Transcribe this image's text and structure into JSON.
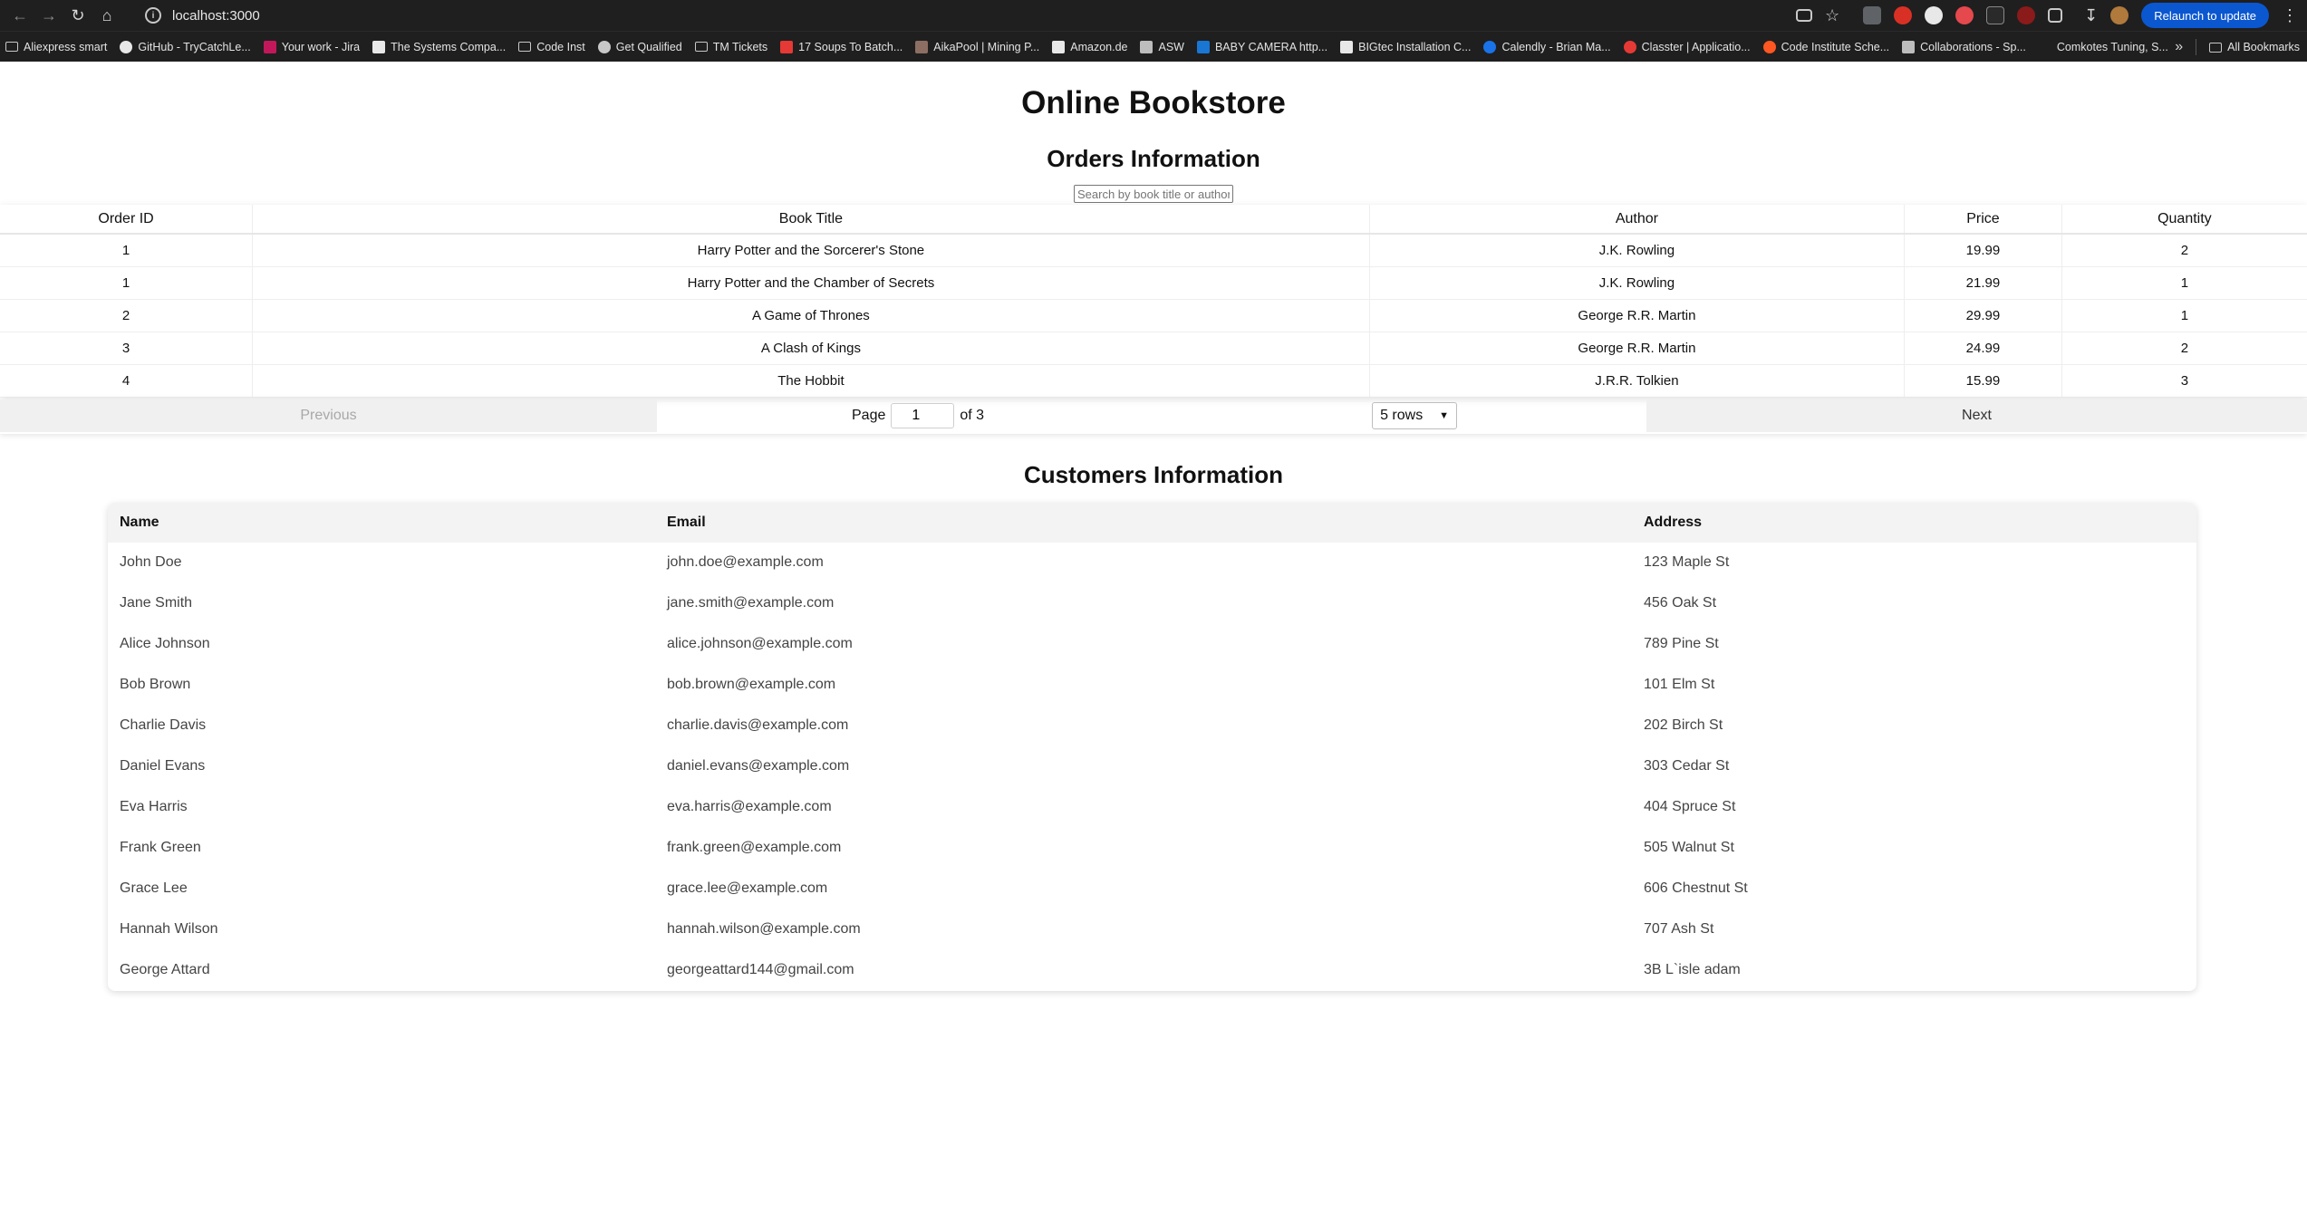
{
  "browser": {
    "url": "localhost:3000",
    "relaunch_label": "Relaunch to update",
    "bookmarks": [
      {
        "label": "Aliexpress smart",
        "icon": "folder-icon"
      },
      {
        "label": "GitHub - TryCatchLe...",
        "icon": "github-icon"
      },
      {
        "label": "Your work - Jira",
        "icon": "jira-icon"
      },
      {
        "label": "The Systems Compa...",
        "icon": "systems-icon"
      },
      {
        "label": "Code Inst",
        "icon": "folder-icon"
      },
      {
        "label": "Get Qualified",
        "icon": "globe-icon"
      },
      {
        "label": "TM Tickets",
        "icon": "folder-icon"
      },
      {
        "label": "17 Soups To Batch...",
        "icon": "soup-icon"
      },
      {
        "label": "AikaPool | Mining P...",
        "icon": "pickaxe-icon"
      },
      {
        "label": "Amazon.de",
        "icon": "amazon-icon"
      },
      {
        "label": "ASW",
        "icon": "asw-icon"
      },
      {
        "label": "BABY CAMERA http...",
        "icon": "camera-icon"
      },
      {
        "label": "BIGtec Installation C...",
        "icon": "bigtec-icon"
      },
      {
        "label": "Calendly - Brian Ma...",
        "icon": "calendly-icon"
      },
      {
        "label": "Classter | Applicatio...",
        "icon": "classter-icon"
      },
      {
        "label": "Code Institute Sche...",
        "icon": "codeinstitute-icon"
      },
      {
        "label": "Collaborations - Sp...",
        "icon": "collab-icon"
      },
      {
        "label": "Comkotes Tuning, S...",
        "icon": "blank-icon"
      }
    ],
    "all_bookmarks_label": "All Bookmarks"
  },
  "app_title": "Online Bookstore",
  "orders": {
    "title": "Orders Information",
    "search_placeholder": "Search by book title or author",
    "columns": [
      "Order ID",
      "Book Title",
      "Author",
      "Price",
      "Quantity"
    ],
    "rows": [
      [
        "1",
        "Harry Potter and the Sorcerer's Stone",
        "J.K. Rowling",
        "19.99",
        "2"
      ],
      [
        "1",
        "Harry Potter and the Chamber of Secrets",
        "J.K. Rowling",
        "21.99",
        "1"
      ],
      [
        "2",
        "A Game of Thrones",
        "George R.R. Martin",
        "29.99",
        "1"
      ],
      [
        "3",
        "A Clash of Kings",
        "George R.R. Martin",
        "24.99",
        "2"
      ],
      [
        "4",
        "The Hobbit",
        "J.R.R. Tolkien",
        "15.99",
        "3"
      ]
    ],
    "pagination": {
      "previous_label": "Previous",
      "page_label": "Page",
      "current_page": "1",
      "of_label": "of 3",
      "rows_option": "5 rows",
      "next_label": "Next"
    }
  },
  "customers": {
    "title": "Customers Information",
    "columns": [
      "Name",
      "Email",
      "Address"
    ],
    "rows": [
      [
        "John Doe",
        "john.doe@example.com",
        "123 Maple St"
      ],
      [
        "Jane Smith",
        "jane.smith@example.com",
        "456 Oak St"
      ],
      [
        "Alice Johnson",
        "alice.johnson@example.com",
        "789 Pine St"
      ],
      [
        "Bob Brown",
        "bob.brown@example.com",
        "101 Elm St"
      ],
      [
        "Charlie Davis",
        "charlie.davis@example.com",
        "202 Birch St"
      ],
      [
        "Daniel Evans",
        "daniel.evans@example.com",
        "303 Cedar St"
      ],
      [
        "Eva Harris",
        "eva.harris@example.com",
        "404 Spruce St"
      ],
      [
        "Frank Green",
        "frank.green@example.com",
        "505 Walnut St"
      ],
      [
        "Grace Lee",
        "grace.lee@example.com",
        "606 Chestnut St"
      ],
      [
        "Hannah Wilson",
        "hannah.wilson@example.com",
        "707 Ash St"
      ],
      [
        "George Attard",
        "georgeattard144@gmail.com",
        "3B L`isle adam"
      ]
    ]
  },
  "colors": {
    "chrome_bg": "#1f1f1f",
    "relaunch_blue": "#0b57d0",
    "button_gray": "#f0f0f0",
    "header_gray": "#f3f3f3"
  }
}
